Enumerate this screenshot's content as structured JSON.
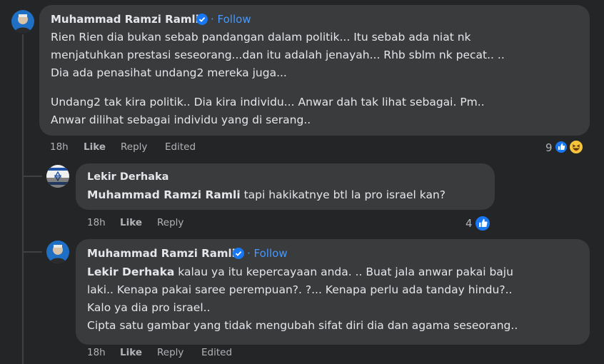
{
  "comments": [
    {
      "author": "Muhammad Ramzi Ramli",
      "follow": "· Follow",
      "lines": [
        "Rien Rien dia bukan sebab pandangan dalam politik... Itu sebab ada niat nk",
        "menjatuhkan prestasi seseorang...dan itu adalah jenayah... Rhb sblm nk pecat.. ..",
        "Dia ada penasihat undang2 mereka juga..."
      ],
      "lines2": [
        "Undang2 tak kira politik.. Dia kira individu... Anwar dah tak lihat sebagai. Pm..",
        "Anwar dilihat sebagai individu yang di serang.."
      ],
      "time": "18h",
      "like": "Like",
      "reply": "Reply",
      "edited": "Edited",
      "reaction_count": "9",
      "reactions": [
        "like-icon",
        "haha-icon"
      ]
    },
    {
      "author": "Lekir Derhaka",
      "mention": "Muhammad Ramzi Ramli",
      "text": "tapi hakikatnye btl la pro israel kan?",
      "time": "18h",
      "like": "Like",
      "reply": "Reply",
      "reaction_count": "4",
      "reactions": [
        "like-icon"
      ]
    },
    {
      "author": "Muhammad Ramzi Ramli",
      "follow": "· Follow",
      "mention": "Lekir Derhaka",
      "line1": "kalau ya itu kepercayaan anda. .. Buat jala anwar pakai baju",
      "lines": [
        "laki.. Kenapa pakai saree perempuan?. ?... Kenapa perlu ada tanday hindu?..",
        "Kalo ya dia pro israel..",
        "Cipta satu gambar yang tidak mengubah sifat diri dia dan agama seseorang.."
      ],
      "time": "18h",
      "like": "Like",
      "reply": "Reply",
      "edited": "Edited"
    }
  ],
  "colors": {
    "background": "#242526",
    "bubble": "#3a3b3c",
    "link": "#4599ff",
    "like_blue": "#1877f2",
    "haha_yellow": "#f7c53b"
  }
}
